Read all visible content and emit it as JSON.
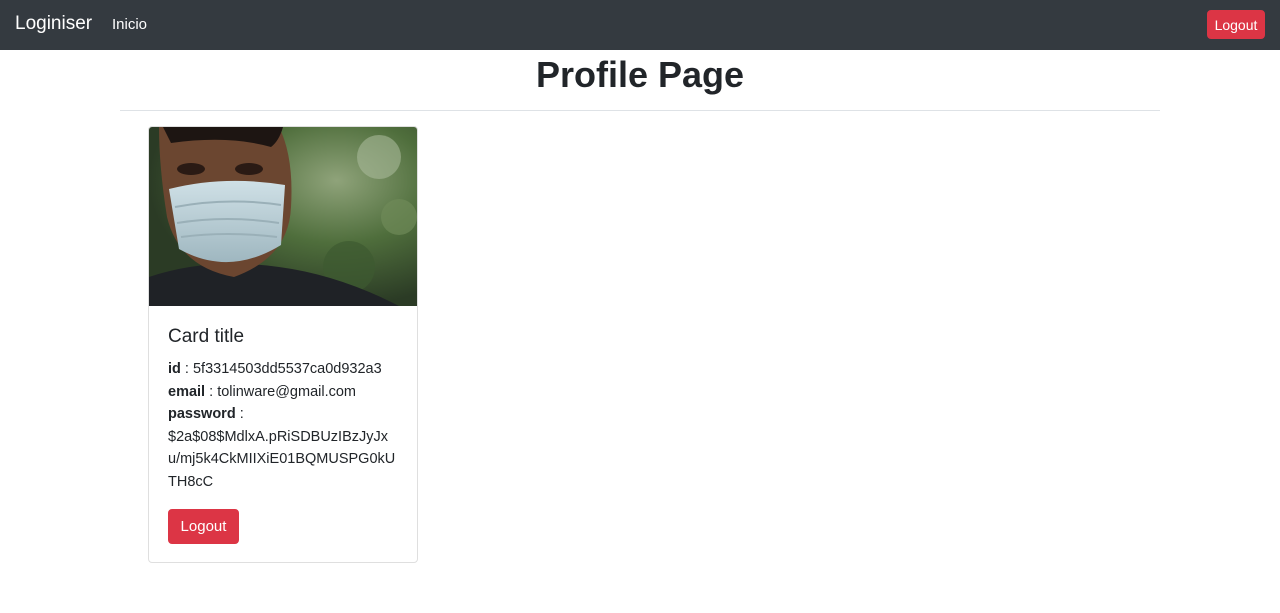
{
  "navbar": {
    "brand": "Loginiser",
    "links": [
      {
        "label": "Inicio"
      }
    ],
    "logout_label": "Logout"
  },
  "page": {
    "title": "Profile Page"
  },
  "card": {
    "image_alt": "profile photo of a man wearing a surgical face mask",
    "title": "Card title",
    "fields": {
      "id_label": "id",
      "id_value": "5f3314503dd5537ca0d932a3",
      "email_label": "email",
      "email_value": "tolinware@gmail.com",
      "password_label": "password",
      "password_value": "$2a$08$MdlxA.pRiSDBUzIBzJyJxu/mj5k4CkMIIXiE01BQMUSPG0kUTH8cC"
    },
    "logout_label": "Logout"
  },
  "colors": {
    "navbar_bg": "#343a40",
    "danger": "#dc3545"
  }
}
